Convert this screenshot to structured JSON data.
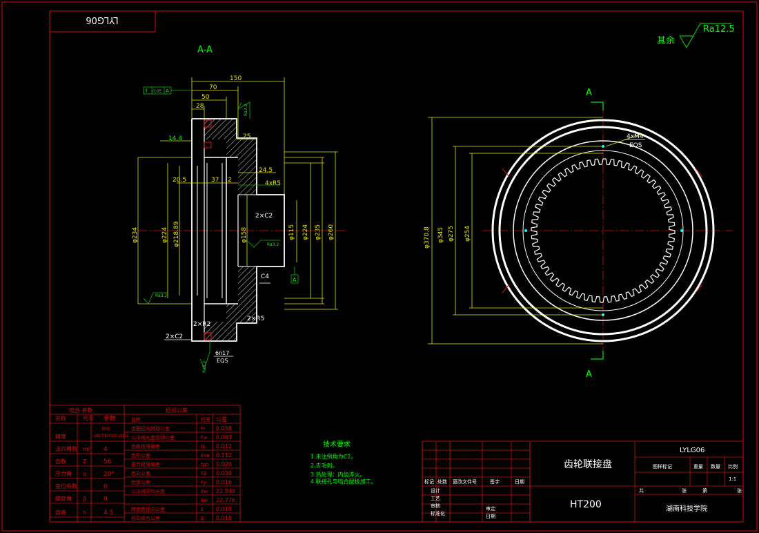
{
  "drawing_no": "LYLG06",
  "drawing_no_rotated": "LYLG06",
  "section_label": "A-A",
  "cut_label_top": "A",
  "cut_label_bottom": "A",
  "roughness_rest": {
    "prefix": "其余",
    "value": "Ra12.5"
  },
  "left_view": {
    "dims_top": [
      "150",
      "70",
      "50",
      "28"
    ],
    "tolerance_frame": [
      "f",
      "0.05",
      "A"
    ],
    "ra_top": "Ra3.2",
    "dim_25": "25",
    "dim_14_4": "14.4",
    "dim_24_5": "24.5",
    "dim_20_5": "20.5",
    "dim_37": "37",
    "dim_2": "2",
    "dim_4xr5": "4xR5",
    "dim_2xc2_mid": "2×C2",
    "diameters": [
      "φ234",
      "φ224",
      "φ218.89",
      "φ158",
      "φ115",
      "φ224",
      "φ235",
      "φ260"
    ],
    "ra_mid": "Ra3.2",
    "ra_left": "Ra3.2",
    "datum": "A",
    "c4": "C4",
    "dim_2xr2": "2×R2",
    "dim_2xr5": "2×R5",
    "dim_2xc2_bot": "2×C2",
    "dim_6n17": "6n17",
    "eqs": "EQS",
    "ra_bot": "Ra3.2"
  },
  "right_view": {
    "diameters": [
      "φ370.8",
      "φ345",
      "φ275",
      "φ254"
    ],
    "holes": "4xM4",
    "eqs": "EQS"
  },
  "gear_params": {
    "header": [
      "啮合",
      "参数"
    ],
    "rows": [
      {
        "name": "名称",
        "sym": "代号",
        "val": "参数"
      },
      {
        "name": "精度",
        "sym": "",
        "val": "8ME GB/T10095-2001"
      },
      {
        "name": "法向模数",
        "sym": "mn",
        "val": "4"
      },
      {
        "name": "齿数",
        "sym": "Z",
        "val": "56"
      },
      {
        "name": "压力角",
        "sym": "α",
        "val": "20°"
      },
      {
        "name": "变位系数",
        "sym": "",
        "val": "0"
      },
      {
        "name": "螺旋角",
        "sym": "β",
        "val": "0"
      },
      {
        "name": "齿高",
        "sym": "h",
        "val": "4.5"
      }
    ]
  },
  "tolerance_table": {
    "header": "检验公差",
    "rows": [
      {
        "name": "名称",
        "sym": "代号",
        "val": "公差"
      },
      {
        "name": "齿圈径向跳动公差",
        "sym": "Fr",
        "val": "0.058"
      },
      {
        "name": "公法线长度变动公差",
        "sym": "Fw",
        "val": "0.063"
      },
      {
        "name": "齿距极限偏差",
        "sym": "fp",
        "val": "0.012"
      },
      {
        "name": "齿形公差",
        "sym": "Esn",
        "val": "0.112"
      },
      {
        "name": "基节极限偏差",
        "sym": "fpb",
        "val": "0.020"
      },
      {
        "name": "齿向公差",
        "sym": "Fβ",
        "val": "0.030"
      },
      {
        "name": "齿厚公差",
        "sym": "Fp",
        "val": "0.016"
      },
      {
        "name": "公法线平均长度",
        "sym": "Ew",
        "val": "22.849"
      },
      {
        "name": "",
        "sym": "Ew",
        "val": "22.776"
      },
      {
        "name": "跨齿数径向公差",
        "sym": "E",
        "val": "0.018"
      },
      {
        "name": "径向综合公差",
        "sym": "E",
        "val": "0.018"
      }
    ]
  },
  "tech_req": {
    "title": "技术要求",
    "items": [
      "1.未注倒角为C2。",
      "2.去毛刺。",
      "3.热处理：内齿淬火。",
      "4.联接孔与啮合配板加工。"
    ]
  },
  "title_block": {
    "part_name": "齿轮联接盘",
    "material": "HT200",
    "code": "LYLG06",
    "cols": [
      "标记",
      "处数",
      "更改文件号",
      "签字",
      "日期"
    ],
    "stage_cols": [
      "图样标记",
      "重量",
      "数量",
      "比例"
    ],
    "scale": "1:1",
    "sheet": [
      "共",
      "张",
      "第",
      "张"
    ],
    "roles": [
      "设计",
      "工艺",
      "审核",
      "标准化"
    ],
    "roles2": [
      "审定",
      "日期"
    ],
    "school": "湖南科技学院"
  }
}
